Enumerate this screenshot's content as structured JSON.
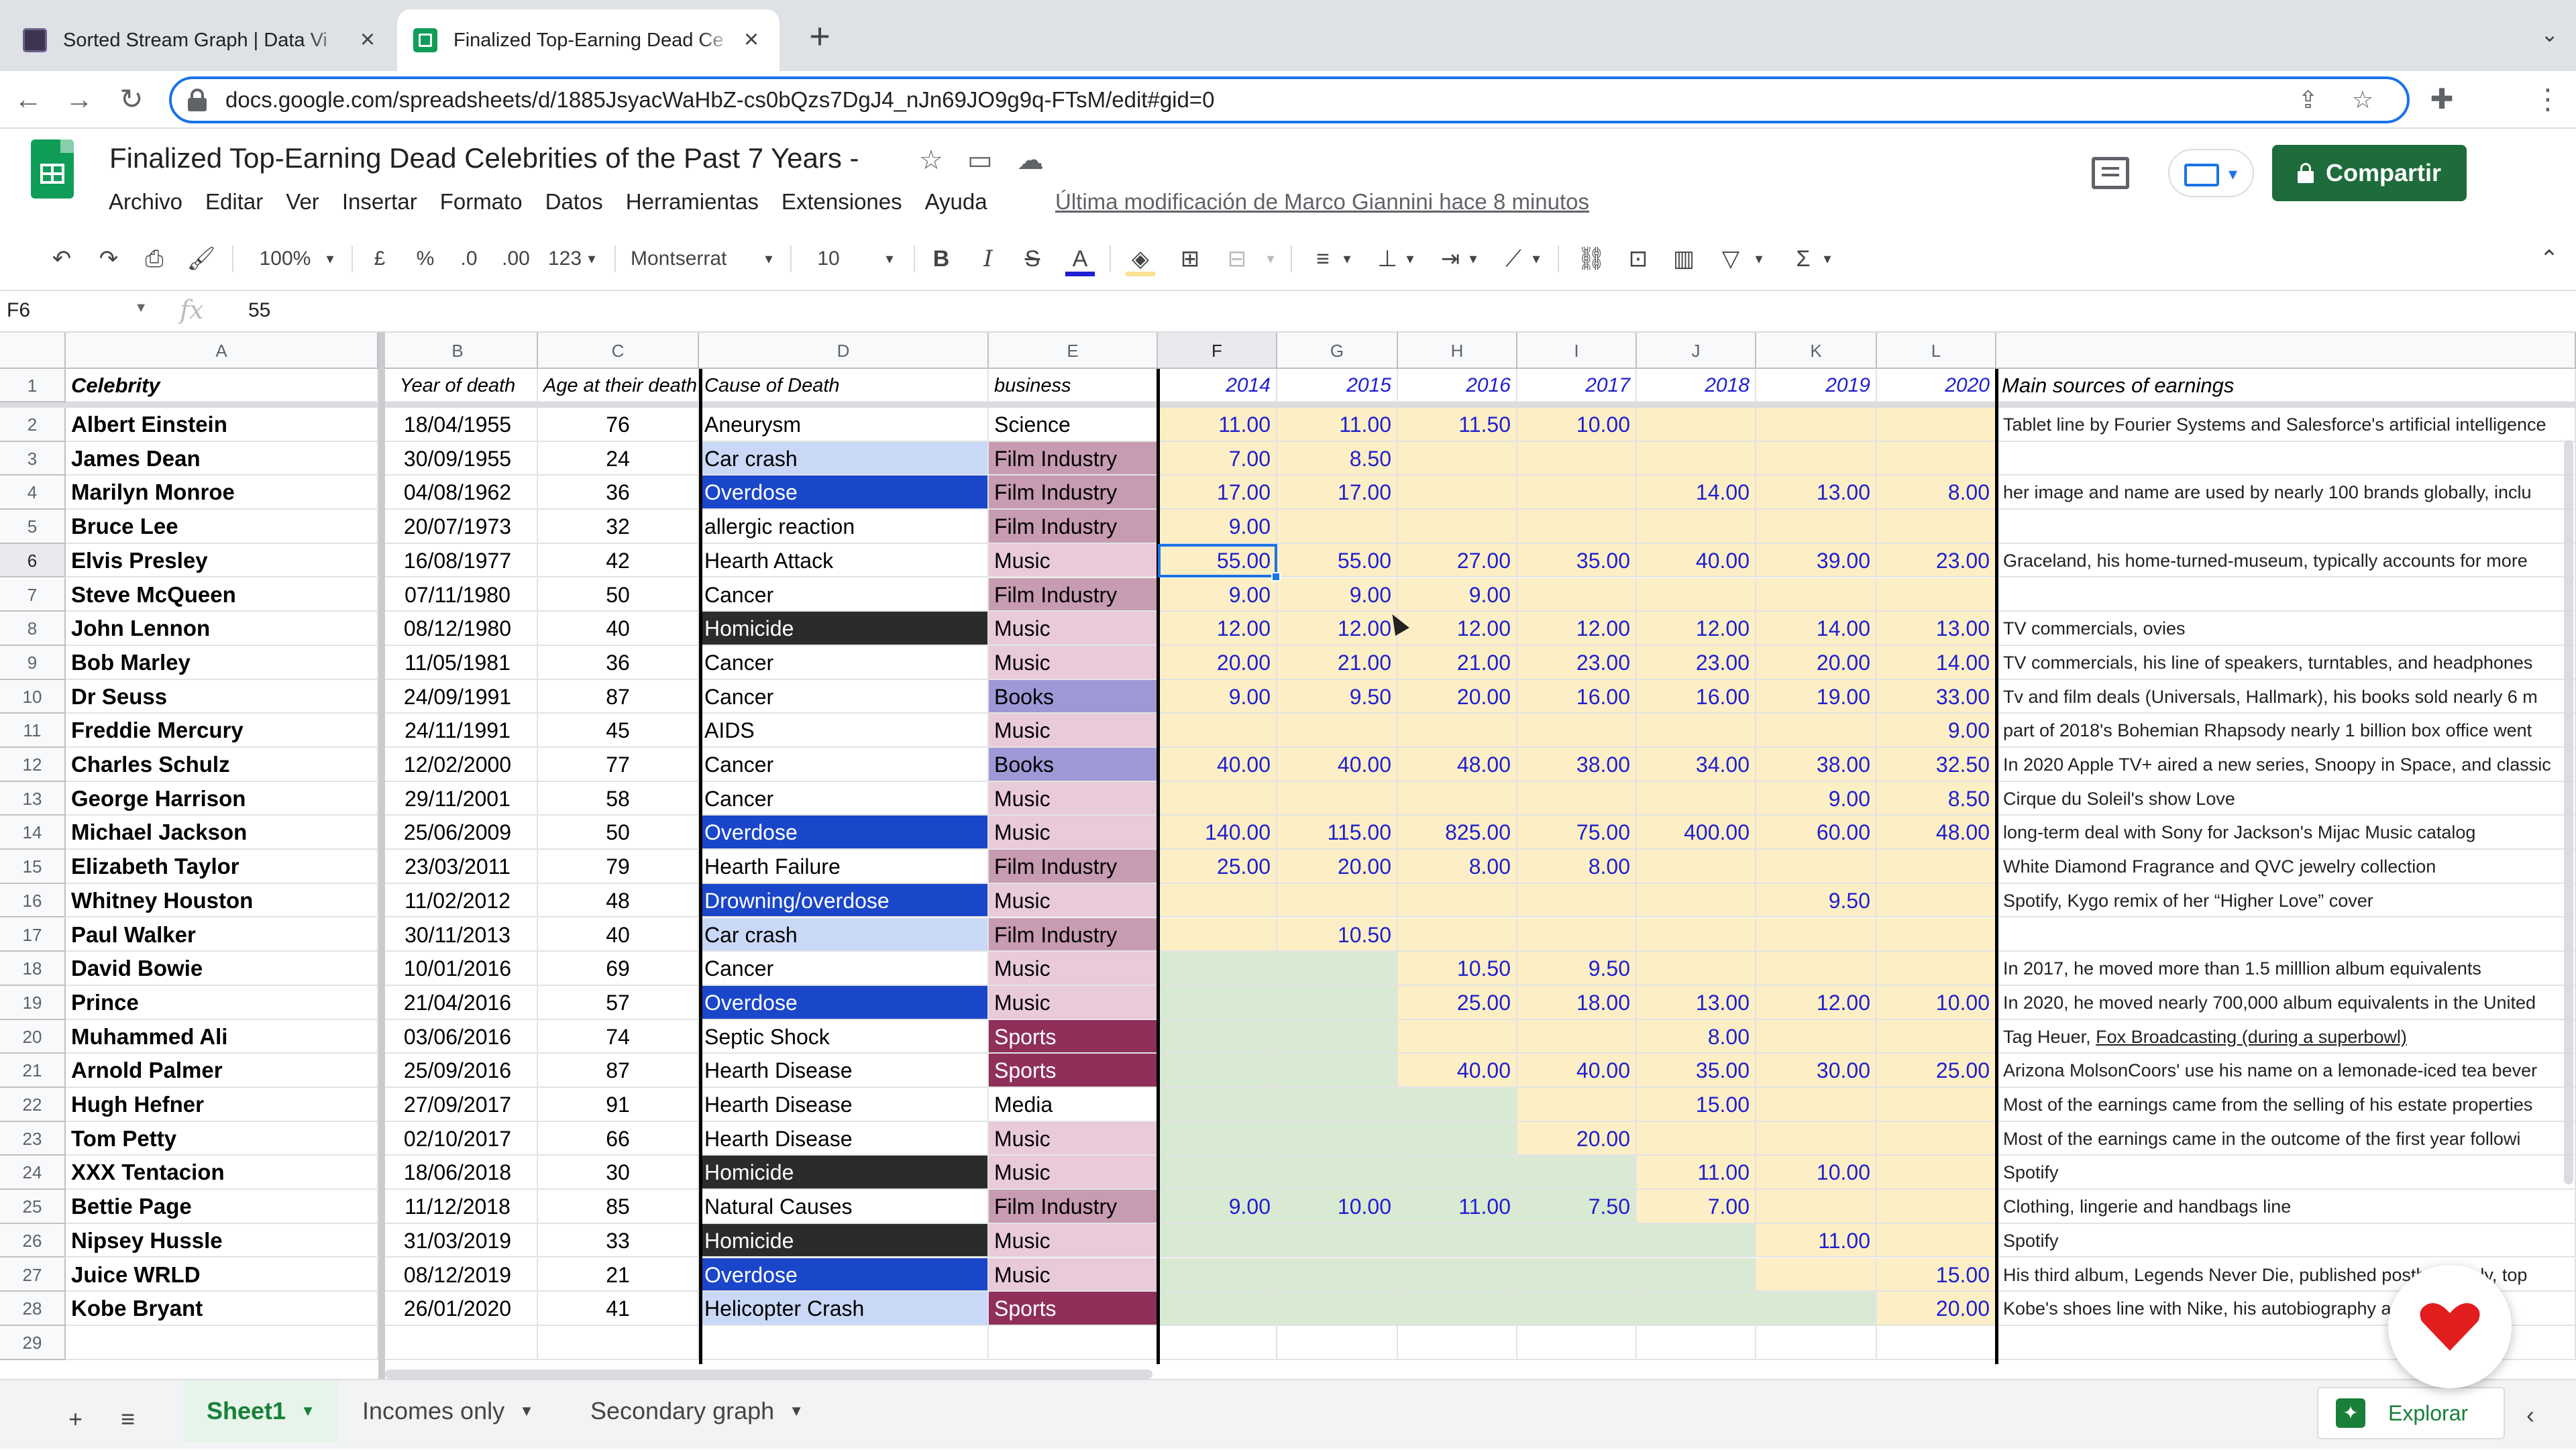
{
  "browser": {
    "tabs": [
      {
        "title": "Sorted Stream Graph | Data Vi"
      },
      {
        "title": "Finalized Top-Earning Dead Ce"
      }
    ],
    "new_tab": "+",
    "url": "docs.google.com/spreadsheets/d/1885JsyacWaHbZ-cs0bQzs7DgJ4_nJn69JO9g9q-FTsM/edit#gid=0"
  },
  "doc": {
    "title": "Finalized Top-Earning Dead Celebrities of the Past 7 Years -",
    "menu": [
      "Archivo",
      "Editar",
      "Ver",
      "Insertar",
      "Formato",
      "Datos",
      "Herramientas",
      "Extensiones",
      "Ayuda"
    ],
    "last_modified": "Última modificación de Marco Giannini hace 8 minutos",
    "share_label": "Compartir"
  },
  "toolbar": {
    "zoom": "100%",
    "currency": "£",
    "percent": "%",
    "dec_less": ".0",
    "dec_more": ".00",
    "format": "123",
    "font": "Montserrat",
    "font_size": "10",
    "bold": "B",
    "italic": "I",
    "strike": "S",
    "text_color": "A"
  },
  "formula_bar": {
    "cell_ref": "F6",
    "fx": "fx",
    "value": "55"
  },
  "grid": {
    "col_letters": [
      "A",
      "B",
      "C",
      "D",
      "E",
      "F",
      "G",
      "H",
      "I",
      "J",
      "K",
      "L",
      ""
    ],
    "header_row": [
      "Celebrity",
      "Year of death",
      "Age at their death",
      "Cause of Death",
      "business",
      "2014",
      "2015",
      "2016",
      "2017",
      "2018",
      "2019",
      "2020",
      "Main sources of earnings"
    ],
    "rows": [
      [
        "Albert Einstein",
        "18/04/1955",
        "76",
        "Aneurysm",
        "Science",
        "11.00",
        "11.00",
        "11.50",
        "10.00",
        "",
        "",
        "",
        "Tablet line by Fourier Systems and Salesforce's artificial intelligence"
      ],
      [
        "James Dean",
        "30/09/1955",
        "24",
        "Car crash",
        "Film Industry",
        "7.00",
        "8.50",
        "",
        "",
        "",
        "",
        "",
        ""
      ],
      [
        "Marilyn Monroe",
        "04/08/1962",
        "36",
        "Overdose",
        "Film Industry",
        "17.00",
        "17.00",
        "",
        "",
        "14.00",
        "13.00",
        "8.00",
        "her image and name are used by nearly 100 brands globally, inclu"
      ],
      [
        "Bruce Lee",
        "20/07/1973",
        "32",
        "allergic reaction",
        "Film Industry",
        "9.00",
        "",
        "",
        "",
        "",
        "",
        "",
        ""
      ],
      [
        "Elvis Presley",
        "16/08/1977",
        "42",
        "Hearth Attack",
        "Music",
        "55.00",
        "55.00",
        "27.00",
        "35.00",
        "40.00",
        "39.00",
        "23.00",
        "Graceland, his home-turned-museum, typically accounts for more"
      ],
      [
        "Steve McQueen",
        "07/11/1980",
        "50",
        "Cancer",
        "Film Industry",
        "9.00",
        "9.00",
        "9.00",
        "",
        "",
        "",
        "",
        ""
      ],
      [
        "John Lennon",
        "08/12/1980",
        "40",
        "Homicide",
        "Music",
        "12.00",
        "12.00",
        "12.00",
        "12.00",
        "12.00",
        "14.00",
        "13.00",
        "TV commercials, ovies"
      ],
      [
        "Bob Marley",
        "11/05/1981",
        "36",
        "Cancer",
        "Music",
        "20.00",
        "21.00",
        "21.00",
        "23.00",
        "23.00",
        "20.00",
        "14.00",
        "TV commercials, his line of speakers, turntables, and headphones"
      ],
      [
        "Dr Seuss",
        "24/09/1991",
        "87",
        "Cancer",
        "Books",
        "9.00",
        "9.50",
        "20.00",
        "16.00",
        "16.00",
        "19.00",
        "33.00",
        "Tv and film deals (Universals, Hallmark), his books sold nearly 6 m"
      ],
      [
        "Freddie Mercury",
        "24/11/1991",
        "45",
        "AIDS",
        "Music",
        "",
        "",
        "",
        "",
        "",
        "",
        "9.00",
        "part of 2018's Bohemian Rhapsody nearly 1 billion box office went"
      ],
      [
        "Charles Schulz",
        "12/02/2000",
        "77",
        "Cancer",
        "Books",
        "40.00",
        "40.00",
        "48.00",
        "38.00",
        "34.00",
        "38.00",
        "32.50",
        "In 2020 Apple TV+ aired a new series, Snoopy in Space, and classic"
      ],
      [
        "George Harrison",
        "29/11/2001",
        "58",
        "Cancer",
        "Music",
        "",
        "",
        "",
        "",
        "",
        "9.00",
        "8.50",
        "Cirque du Soleil's show Love"
      ],
      [
        "Michael Jackson",
        "25/06/2009",
        "50",
        "Overdose",
        "Music",
        "140.00",
        "115.00",
        "825.00",
        "75.00",
        "400.00",
        "60.00",
        "48.00",
        "long-term deal with Sony for Jackson's Mijac Music catalog"
      ],
      [
        "Elizabeth Taylor",
        "23/03/2011",
        "79",
        "Hearth Failure",
        "Film Industry",
        "25.00",
        "20.00",
        "8.00",
        "8.00",
        "",
        "",
        "",
        "White Diamond Fragrance and QVC jewelry collection"
      ],
      [
        "Whitney Houston",
        "11/02/2012",
        "48",
        "Drowning/overdose",
        "Music",
        "",
        "",
        "",
        "",
        "",
        "9.50",
        "",
        "Spotify, Kygo remix of her “Higher Love” cover"
      ],
      [
        "Paul Walker",
        "30/11/2013",
        "40",
        "Car crash",
        "Film Industry",
        "",
        "10.50",
        "",
        "",
        "",
        "",
        "",
        ""
      ],
      [
        "David Bowie",
        "10/01/2016",
        "69",
        "Cancer",
        "Music",
        "",
        "",
        "10.50",
        "9.50",
        "",
        "",
        "",
        "In 2017, he moved more than 1.5 milllion album equivalents"
      ],
      [
        "Prince",
        "21/04/2016",
        "57",
        "Overdose",
        "Music",
        "",
        "",
        "25.00",
        "18.00",
        "13.00",
        "12.00",
        "10.00",
        "In 2020, he moved nearly 700,000 album equivalents in the United"
      ],
      [
        "Muhammed Ali",
        "03/06/2016",
        "74",
        "Septic Shock",
        "Sports",
        "",
        "",
        "",
        "",
        "8.00",
        "",
        "",
        "Tag Heuer, Fox Broadcasting (during a superbowl)"
      ],
      [
        "Arnold Palmer",
        "25/09/2016",
        "87",
        "Hearth Disease",
        "Sports",
        "",
        "",
        "40.00",
        "40.00",
        "35.00",
        "30.00",
        "25.00",
        "Arizona MolsonCoors' use his name on a lemonade-iced tea bever"
      ],
      [
        "Hugh Hefner",
        "27/09/2017",
        "91",
        "Hearth Disease",
        "Media",
        "",
        "",
        "",
        "",
        "15.00",
        "",
        "",
        "Most of the earnings came from the selling of his estate properties"
      ],
      [
        "Tom Petty",
        "02/10/2017",
        "66",
        "Hearth Disease",
        "Music",
        "",
        "",
        "",
        "20.00",
        "",
        "",
        "",
        "Most of the earnings came in the outcome of the first year followi"
      ],
      [
        "XXX Tentacion",
        "18/06/2018",
        "30",
        "Homicide",
        "Music",
        "",
        "",
        "",
        "",
        "11.00",
        "10.00",
        "",
        "Spotify"
      ],
      [
        "Bettie Page",
        "11/12/2018",
        "85",
        "Natural Causes",
        "Film Industry",
        "9.00",
        "10.00",
        "11.00",
        "7.50",
        "7.00",
        "",
        "",
        "Clothing, lingerie and handbags line"
      ],
      [
        "Nipsey Hussle",
        "31/03/2019",
        "33",
        "Homicide",
        "Music",
        "",
        "",
        "",
        "",
        "",
        "11.00",
        "",
        "Spotify"
      ],
      [
        "Juice WRLD",
        "08/12/2019",
        "21",
        "Overdose",
        "Music",
        "",
        "",
        "",
        "",
        "",
        "",
        "15.00",
        "His third album, Legends Never Die, published posthumously, top"
      ],
      [
        "Kobe Bryant",
        "26/01/2020",
        "41",
        "Helicopter Crash",
        "Sports",
        "",
        "",
        "",
        "",
        "",
        "",
        "20.00",
        "Kobe's shoes line with Nike, his autobiography and more t"
      ],
      [
        "",
        "",
        "",
        "",
        "",
        "",
        "",
        "",
        "",
        "",
        "",
        "",
        ""
      ]
    ]
  },
  "colors": {
    "yellow_fill": "#fdefc5",
    "green_fill": "#d9ead3",
    "car_crash": "#c9d8f7",
    "overdose": "#1a46c9",
    "homicide": "#2b2b2b",
    "film_industry": "#c79bb1",
    "music": "#e9cad8",
    "books": "#9f98d6",
    "sports": "#8f2f5a",
    "number_blue": "#1f1fcf",
    "share_green": "#1e6b3b"
  },
  "sheets": {
    "tabs": [
      "Sheet1",
      "Incomes only",
      "Secondary graph"
    ],
    "active": "Sheet1",
    "explore_label": "Explorar"
  },
  "icons": {
    "back": "arrow-left-icon",
    "forward": "arrow-right-icon",
    "reload": "reload-icon",
    "star": "star-icon",
    "folder": "move-folder-icon",
    "cloud": "cloud-status-icon",
    "comment": "comment-icon",
    "present": "present-icon",
    "lock": "lock-icon"
  }
}
